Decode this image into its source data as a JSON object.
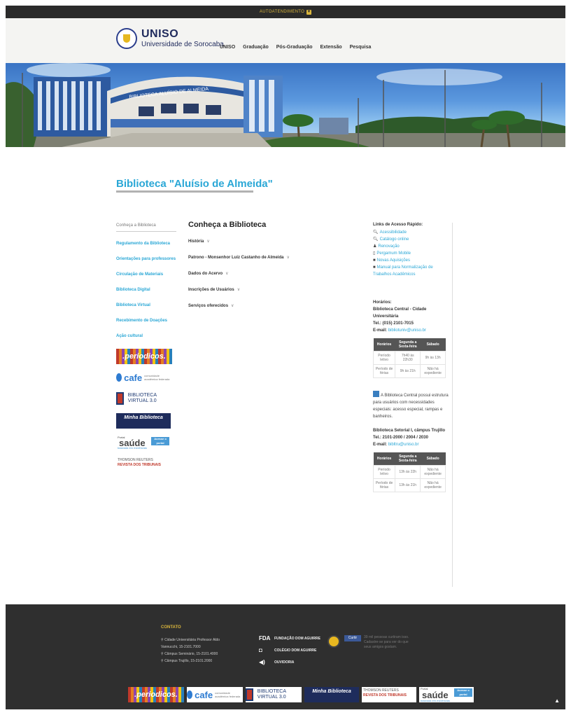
{
  "topbar": {
    "label": "AUTOATENDIMENTO"
  },
  "header": {
    "logo_line1": "UNISO",
    "logo_line2": "Universidade de Sorocaba",
    "nav": [
      "UNISO",
      "Graduação",
      "Pós-Graduação",
      "Extensão",
      "Pesquisa"
    ]
  },
  "hero": {
    "facade_text": "BIBLIOTECA ALUÍSIO DE ALMEIDA"
  },
  "page_title": "Biblioteca \"Aluísio de Almeida\"",
  "sidebar": {
    "items": [
      "Conheça a Biblioteca",
      "Regulamento da Biblioteca",
      "Orientações para professores",
      "Circulação de Materiais",
      "Biblioteca Digital",
      "Biblioteca Virtual",
      "Recebimento de Doações",
      "Ação cultural"
    ],
    "banners": {
      "periodicos": ".periodicos.",
      "cafe": "cafe",
      "cafe_sub": "comunidade acadêmica federada",
      "bv": "BIBLIOTECA VIRTUAL 3.0",
      "minha": "Minha Biblioteca",
      "saude": "saúde",
      "saude_prefix": "Portal",
      "saude_sub": "baseada em evidências",
      "saude_box": "Acesse o portal",
      "thomson": "THOMSON REUTERS",
      "thomson_sub": "REVISTA DOS TRIBUNAIS"
    }
  },
  "main": {
    "heading": "Conheça a Biblioteca",
    "accordions": [
      "História",
      "Patrono - Monsenhor Luiz Castanho de Almeida",
      "Dados do Acervo",
      "Inscrições de Usuários",
      "Serviços oferecidos"
    ]
  },
  "right": {
    "quick_title": "Links de Acesso Rápido:",
    "quick_links": [
      {
        "icon": "search-icon",
        "label": "Acessibilidade"
      },
      {
        "icon": "search-icon",
        "label": "Catálogo online"
      },
      {
        "icon": "user-icon",
        "label": "Renovação"
      },
      {
        "icon": "mobile-icon",
        "label": "Pergamum Mobile"
      },
      {
        "icon": "book-icon",
        "label": "Novas Aquisições"
      },
      {
        "icon": "book-icon",
        "label": "Manual para Normalização de Trabalhos Acadêmicos"
      }
    ],
    "hours_title": "Horários:",
    "central_name": "Biblioteca Central - Cidade Universitária",
    "central_tel": "Tel.: (015) 2101-7015",
    "central_email_label": "E-mail:",
    "central_email": "bibliotuniv@uniso.br",
    "table_headers": [
      "Horários",
      "Segunda a Sexta-feira",
      "Sábado"
    ],
    "central_rows": [
      [
        "Período letivo",
        "7h40 às 22h30",
        "9h às 13h"
      ],
      [
        "Período de férias",
        "9h às 21h",
        "Não há expediente"
      ]
    ],
    "access_note": "A Biblioteca Central possui estrutura para usuários com necessidades especiais: acesso especial, rampas e banheiros.",
    "setorial_name": "Biblioteca Setorial I, câmpus Trujillo",
    "setorial_tel": "Tel.: 2101-2000 / 2004 / 2030",
    "setorial_email_label": "E-mail:",
    "setorial_email": "bibltru@uniso.br",
    "setorial_rows": [
      [
        "Período letivo",
        "13h às 22h",
        "Não há expediente"
      ],
      [
        "Período de férias",
        "13h às 21h",
        "Não há expediente"
      ]
    ]
  },
  "footer": {
    "contact_title": "CONTATO",
    "contacts": [
      "Cidade Universitária Professor Aldo",
      "Vannucchi, 15-2101.7000",
      "Câmpus Seminário, 15-2101.4000",
      "Câmpus Trujillo, 15-2101.2000"
    ],
    "links": [
      {
        "mark": "FDA",
        "label": "FUNDAÇÃO DOM AGUIRRE"
      },
      {
        "mark": "◘",
        "label": "COLÉGIO DOM AGUIRRE"
      },
      {
        "mark": "◀)",
        "label": "OUVIDORIA"
      }
    ],
    "fb_button": "Curtir",
    "fb_text": "39 mil pessoas curtiram isso. Cadastre-se para ver do que seus amigos gostam."
  }
}
